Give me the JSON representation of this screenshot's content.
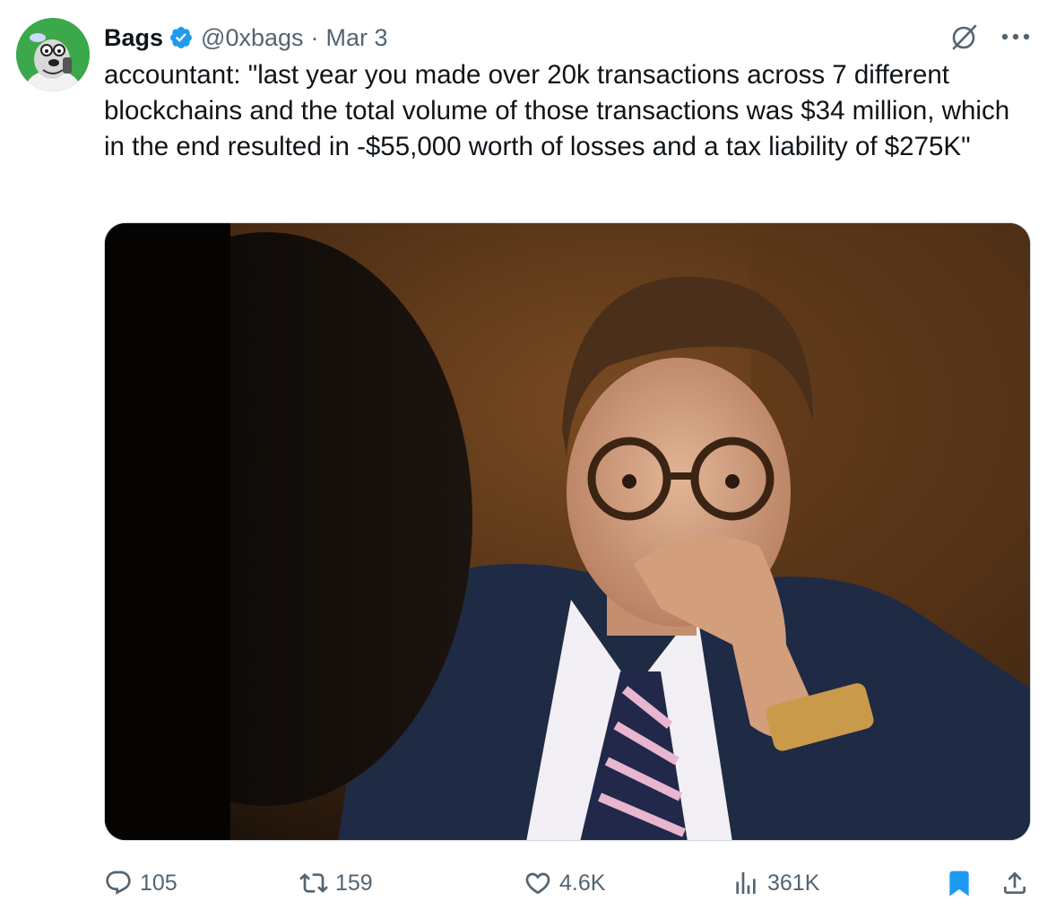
{
  "author": {
    "name": "Bags",
    "handle": "@0xbags",
    "separator": "·",
    "date": "Mar 3"
  },
  "tweet": {
    "text": "accountant: \"last year you made over 20k transactions across 7 different blockchains and the total volume of those transactions was $34 million, which in the end resulted in -$55,000 worth of losses and a tax liability of $275K\""
  },
  "icons": {
    "verified": "verified-badge-icon",
    "grok": "grok-icon",
    "more": "more-icon",
    "reply": "reply-icon",
    "retweet": "retweet-icon",
    "like": "like-icon",
    "views": "views-icon",
    "bookmark": "bookmark-icon",
    "share": "share-icon"
  },
  "stats": {
    "replies": "105",
    "retweets": "159",
    "likes": "4.6K",
    "views": "361K"
  },
  "colors": {
    "accent": "#1d9bf0",
    "secondary_text": "#536471",
    "primary_text": "#0f1419",
    "avatar_bg": "#3aa84b"
  }
}
